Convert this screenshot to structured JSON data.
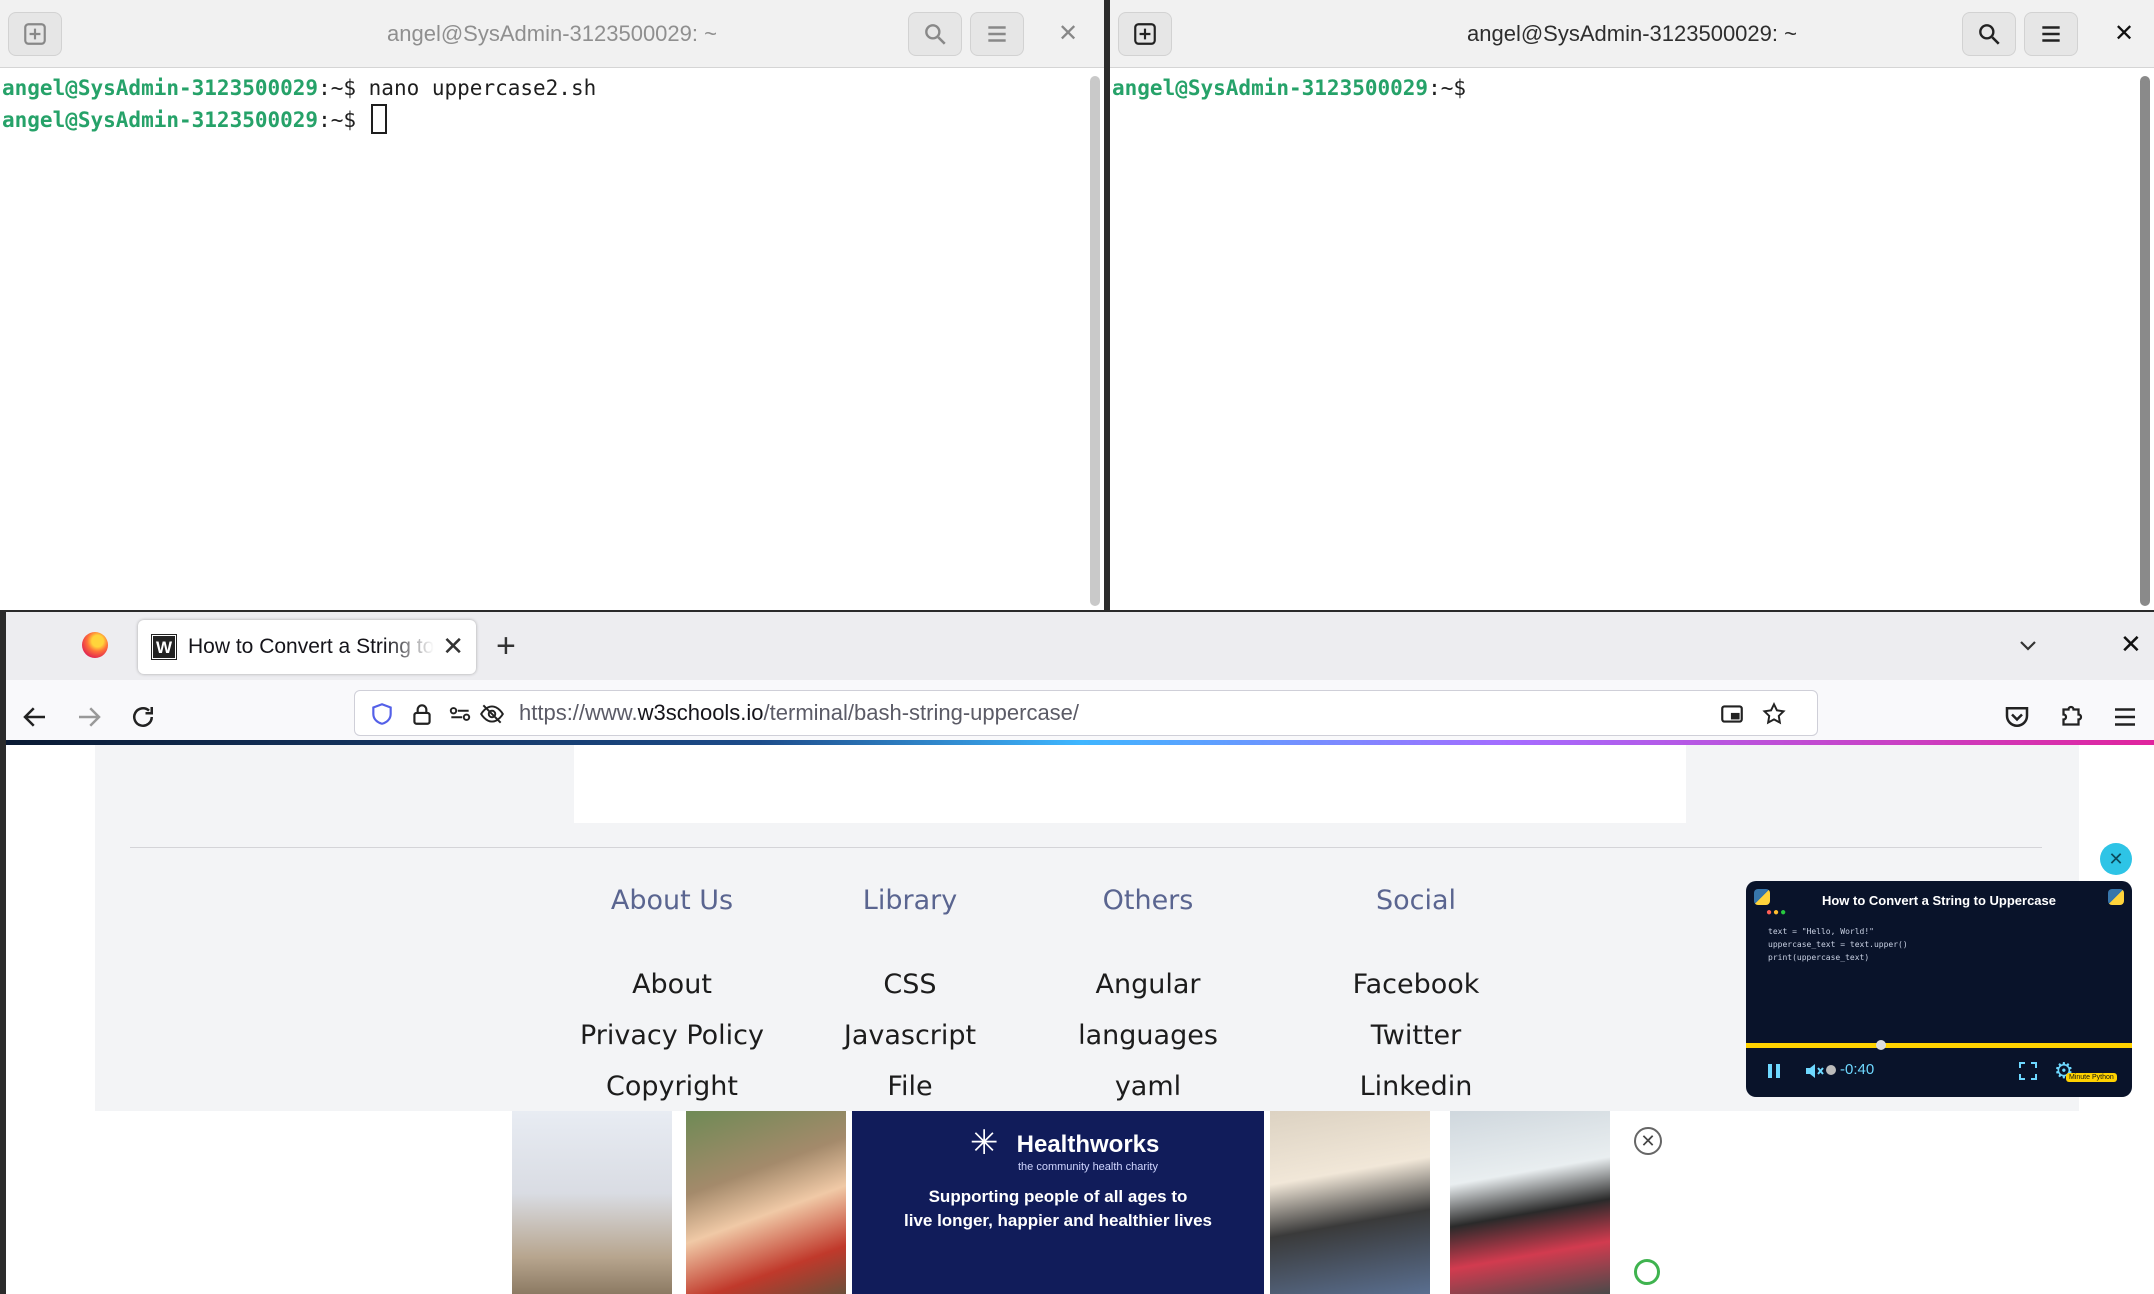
{
  "term_left": {
    "title": "angel@SysAdmin-3123500029: ~",
    "lines": [
      {
        "prompt_user": "angel@SysAdmin-3123500029",
        "prompt_sep": ":~$ ",
        "command": "nano uppercase2.sh"
      },
      {
        "prompt_user": "angel@SysAdmin-3123500029",
        "prompt_sep": ":~$ ",
        "command": ""
      }
    ]
  },
  "term_right": {
    "title": "angel@SysAdmin-3123500029: ~",
    "lines": [
      {
        "prompt_user": "angel@SysAdmin-3123500029",
        "prompt_sep": ":~$",
        "command": ""
      }
    ]
  },
  "browser": {
    "tab_title": "How to Convert a String to Uppercase in Bash",
    "tab_favicon": "W",
    "url_prefix": "https://www.",
    "url_domain": "w3schools.io",
    "url_path": "/terminal/bash-string-uppercase/",
    "footer": {
      "columns": [
        {
          "heading": "About Us",
          "items": [
            "About",
            "Privacy Policy",
            "Copyright"
          ]
        },
        {
          "heading": "Library",
          "items": [
            "CSS",
            "Javascript",
            "File Extension"
          ]
        },
        {
          "heading": "Others",
          "items": [
            "Angular",
            "languages",
            "yaml"
          ]
        },
        {
          "heading": "Social",
          "items": [
            "Facebook",
            "Twitter",
            "Linkedin"
          ]
        }
      ]
    },
    "video": {
      "title": "How to Convert a String to Uppercase",
      "code": "text = \"Hello, World!\"\nuppercase_text = text.upper()\nprint(uppercase_text)",
      "time": "-0:40",
      "badge": "Minute Python",
      "progress": 0.35
    },
    "ad": {
      "brand": "Healthworks",
      "subtitle": "the community health charity",
      "tagline_1": "Supporting people of all ages to",
      "tagline_2": "live longer, happier and healthier lives"
    }
  },
  "colors": {
    "prompt_green": "#26a269",
    "footer_heading": "#5a6590",
    "ad_navy": "#111c5a"
  }
}
